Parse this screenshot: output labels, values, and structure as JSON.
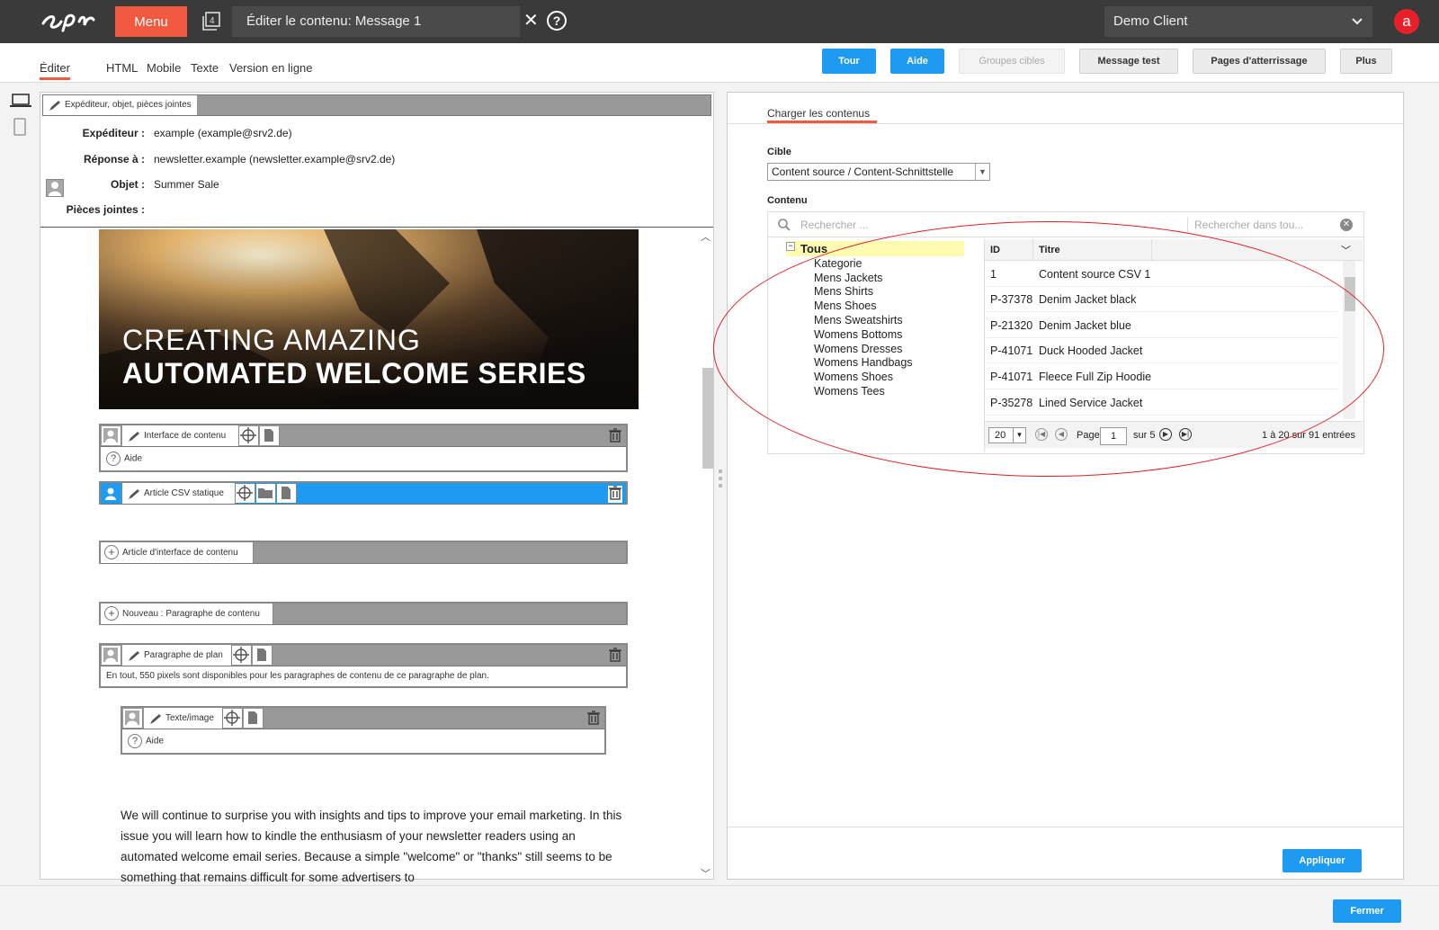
{
  "topbar": {
    "logo": "epi",
    "menu_label": "Menu",
    "tab_title": "Éditer le contenu: Message 1",
    "close_symbol": "✕",
    "help_symbol": "?",
    "client": "Demo Client",
    "avatar_letter": "a"
  },
  "view_tabs": [
    "Éditer",
    "HTML",
    "Mobile",
    "Texte",
    "Version en ligne"
  ],
  "toolbar": {
    "tour": "Tour",
    "aide": "Aide",
    "groupes_cibles": "Groupes cibles",
    "message_test": "Message test",
    "landing_pages": "Pages d'atterrissage",
    "plus": "Plus"
  },
  "editor": {
    "header_block_label": "Expéditeur, objet, pièces jointes",
    "sender_label": "Expéditeur :",
    "sender_value": "example (example@srv2.de)",
    "reply_label": "Réponse à :",
    "reply_value": "newsletter.example (newsletter.example@srv2.de)",
    "subject_label": "Objet :",
    "subject_value": "Summer Sale",
    "attachments_label": "Pièces jointes :",
    "hero_line1": "CREATING AMAZING",
    "hero_line2": "AUTOMATED WELCOME SERIES",
    "blocks": {
      "interface": "Interface de contenu",
      "interface_help": "Aide",
      "csv": "Article CSV statique",
      "article_interface": "Article d'interface de contenu",
      "new_paragraph": "Nouveau : Paragraphe de contenu",
      "plan": "Paragraphe de plan",
      "plan_info": "En tout, 550 pixels sont disponibles pour les paragraphes de contenu de ce paragraphe de plan.",
      "text_image": "Texte/image",
      "text_image_help": "Aide"
    },
    "body_text": "We will continue to surprise you with insights and tips to improve your email marketing. In this issue you will learn how to kindle the enthusiasm of your newsletter readers using an automated welcome email series. Because a simple \"welcome\" or \"thanks\" still seems to be something that remains difficult for some advertisers to"
  },
  "load_panel": {
    "tab_label": "Charger les contenus",
    "target_label": "Cible",
    "target_value": "Content source / Content-Schnittstelle",
    "content_label": "Contenu",
    "search_placeholder": "Rechercher ...",
    "search_scope": "Rechercher dans tou...",
    "tree_root": "Tous",
    "tree_items": [
      "Kategorie",
      "Mens Jackets",
      "Mens Shirts",
      "Mens Shoes",
      "Mens Sweatshirts",
      "Womens Bottoms",
      "Womens Dresses",
      "Womens Handbags",
      "Womens Shoes",
      "Womens Tees"
    ],
    "grid_headers": {
      "id": "ID",
      "titre": "Titre"
    },
    "rows": [
      {
        "id": "1",
        "title": "Content source CSV 1"
      },
      {
        "id": "P-37378",
        "title": "Denim Jacket black"
      },
      {
        "id": "P-21320",
        "title": "Denim Jacket blue"
      },
      {
        "id": "P-41071",
        "title": "Duck Hooded Jacket"
      },
      {
        "id": "P-41071",
        "title": "Fleece Full Zip Hoodie"
      },
      {
        "id": "P-35278",
        "title": "Lined Service Jacket"
      }
    ],
    "pager": {
      "page_size": "20",
      "page_label": "Page",
      "page_value": "1",
      "of_label": "sur 5",
      "info": "1 à 20 sur 91 entrées"
    },
    "apply_label": "Appliquer"
  },
  "footer": {
    "close_label": "Fermer"
  },
  "colors": {
    "accent": "#f15a3f",
    "primary": "#1e9bf0",
    "annotation": "#e31e24"
  }
}
